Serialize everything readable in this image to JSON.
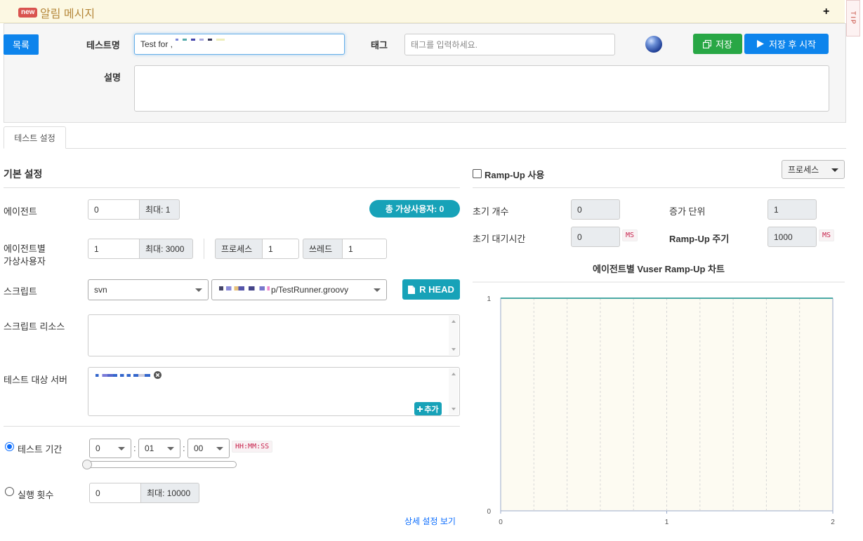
{
  "notice": {
    "badge": "new",
    "title": "알림 메시지",
    "expand": "+"
  },
  "tip": "TIP",
  "header": {
    "list_button": "목록",
    "test_name_label": "테스트명",
    "test_name_value": "Test for ,",
    "tag_label": "태그",
    "tag_placeholder": "태그를 입력하세요.",
    "description_label": "설명",
    "save_button": "저장",
    "save_start_button": "저장 후 시작"
  },
  "tabs": [
    {
      "label": "테스트 설정"
    }
  ],
  "basic": {
    "title": "기본 설정",
    "agent_label": "에이전트",
    "agent_value": "0",
    "agent_max": "최대: 1",
    "total_vusers": "총 가상사용자: 0",
    "vuser_label_1": "에이전트별",
    "vuser_label_2": "가상사용자",
    "vuser_value": "1",
    "vuser_max": "최대: 3000",
    "process_label": "프로세스",
    "process_value": "1",
    "thread_label": "쓰레드",
    "thread_value": "1",
    "script_label": "스크립트",
    "script_repo": "svn",
    "script_file": "p/TestRunner.groovy",
    "rhead_button": "R HEAD",
    "script_resource_label": "스크립트 리소스",
    "target_server_label": "테스트 대상 서버",
    "add_button": "추가",
    "duration_label": "테스트 기간",
    "duration_hours": "0",
    "duration_minutes": "01",
    "duration_seconds": "00",
    "duration_sep": ":",
    "duration_format": "HH:MM:SS",
    "duration_progress": 0,
    "run_count_label": "실행 횟수",
    "run_count_value": "0",
    "run_count_max": "최대: 10000",
    "detail_link": "상세 설정 보기"
  },
  "rampup": {
    "checkbox_label": "Ramp-Up 사용",
    "enabled": false,
    "mode_select": "프로세스",
    "initial_count_label": "초기 개수",
    "initial_count_value": "0",
    "increment_label": "증가 단위",
    "increment_value": "1",
    "initial_wait_label": "초기 대기시간",
    "initial_wait_value": "0",
    "initial_wait_unit": "MS",
    "period_label": "Ramp-Up 주기",
    "period_value": "1000",
    "period_unit": "MS"
  },
  "chart_data": {
    "type": "line",
    "title": "에이전트별 Vuser Ramp-Up 차트",
    "x": [
      0,
      2
    ],
    "series": [
      {
        "values": [
          1,
          1
        ]
      }
    ],
    "xlim": [
      0,
      2
    ],
    "ylim": [
      0,
      1
    ],
    "x_ticks": [
      "0",
      "1",
      "2"
    ],
    "y_ticks": [
      "0",
      "1"
    ],
    "line_color": "#4aa9a5",
    "background": "#fdfbf2",
    "grid": true
  }
}
